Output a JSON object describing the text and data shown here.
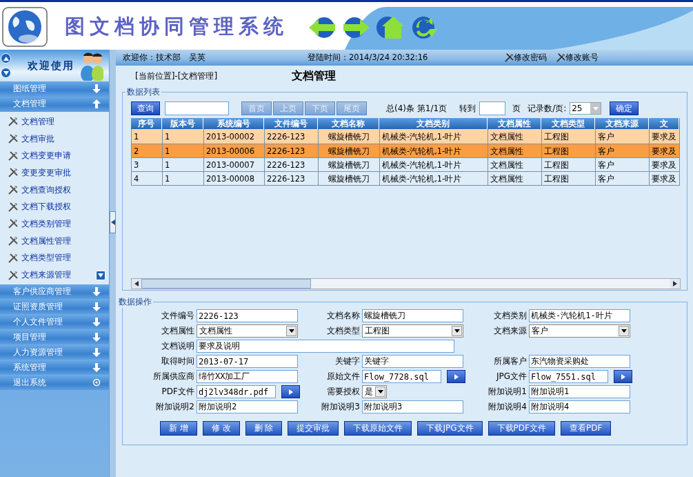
{
  "header": {
    "title": "图文档协同管理系统"
  },
  "sidebar": {
    "banner": "欢迎使用",
    "groups": [
      {
        "label": "图纸管理",
        "kind": "group",
        "expanded": false
      },
      {
        "label": "文档管理",
        "kind": "group",
        "expanded": true,
        "children": [
          "文档管理",
          "文档审批",
          "文档变更申请",
          "变更变更审批",
          "文档查询授权",
          "文档下载授权",
          "文档类别管理",
          "文档属性管理",
          "文档类型管理",
          "文档来源管理"
        ]
      },
      {
        "label": "客户供应商管理",
        "kind": "group",
        "expanded": false
      },
      {
        "label": "证照资质管理",
        "kind": "group",
        "expanded": false
      },
      {
        "label": "个人文件管理",
        "kind": "group",
        "expanded": false
      },
      {
        "label": "项目管理",
        "kind": "group",
        "expanded": false
      },
      {
        "label": "人力资源管理",
        "kind": "group",
        "expanded": false
      },
      {
        "label": "系统管理",
        "kind": "group",
        "expanded": false
      },
      {
        "label": "退出系统",
        "kind": "exit",
        "expanded": false
      }
    ]
  },
  "topbar": {
    "welcome": "欢迎你：",
    "department": "技术部",
    "user": "吴英",
    "login_time": "登陆时间：2014/3/24 20:32:16",
    "links": [
      "修改密码",
      "修改账号"
    ]
  },
  "breadcrumb": "[当前位置]-[文档管理]",
  "page_title": "文档管理",
  "list": {
    "legend": "数据列表",
    "query_button": "查询",
    "pager_buttons": [
      {
        "label": "首页",
        "disabled": true
      },
      {
        "label": "上页",
        "disabled": true
      },
      {
        "label": "下页",
        "disabled": true
      },
      {
        "label": "尾页",
        "disabled": true
      }
    ],
    "summary": "总(4)条 第1/1页",
    "goto_label": "转到",
    "page_unit": "页",
    "per_page_label": "记录数/页:",
    "per_page": "25",
    "confirm_button": "确定",
    "columns": [
      "序号",
      "版本号",
      "系统编号",
      "文件编号",
      "文档名称",
      "文档类别",
      "文档属性",
      "文档类型",
      "文档来源",
      "文"
    ],
    "rows": [
      {
        "cells": [
          "1",
          "1",
          "2013-00002",
          "2226-123",
          "螺旋槽铣刀",
          "机械类-汽轮机,1-叶片",
          "文档属性",
          "工程图",
          "客户",
          "要求及"
        ],
        "hovered": true,
        "selected": false
      },
      {
        "cells": [
          "2",
          "1",
          "2013-00006",
          "2226-123",
          "螺旋槽铣刀",
          "机械类-汽轮机,1-叶片",
          "文档属性",
          "工程图",
          "客户",
          "要求及"
        ],
        "hovered": false,
        "selected": true
      },
      {
        "cells": [
          "3",
          "1",
          "2013-00007",
          "2226-123",
          "螺旋槽铣刀",
          "机械类-汽轮机,1-叶片",
          "文档属性",
          "工程图",
          "客户",
          "要求及"
        ],
        "hovered": false,
        "selected": false
      },
      {
        "cells": [
          "4",
          "1",
          "2013-00008",
          "2226-123",
          "螺旋槽铣刀",
          "机械类-汽轮机,1-叶片",
          "文档属性",
          "工程图",
          "客户",
          "要求及"
        ],
        "hovered": false,
        "selected": false
      }
    ]
  },
  "form": {
    "legend": "数据操作",
    "rows": [
      [
        {
          "label": "文件编号",
          "kind": "text",
          "value": "2226-123"
        },
        {
          "label": "文档名称",
          "kind": "text",
          "value": "螺旋槽铣刀"
        },
        {
          "label": "文档类别",
          "kind": "text",
          "value": "机械类-汽轮机1-叶片"
        }
      ],
      [
        {
          "label": "文档属性",
          "kind": "select",
          "value": "文档属性"
        },
        {
          "label": "文档类型",
          "kind": "select",
          "value": "工程图"
        },
        {
          "label": "文档来源",
          "kind": "select",
          "value": "客户"
        }
      ],
      [
        {
          "label": "文档说明",
          "kind": "wide",
          "value": "要求及说明"
        }
      ],
      [
        {
          "label": "取得时间",
          "kind": "text",
          "value": "2013-07-17"
        },
        {
          "label": "关键字",
          "kind": "text",
          "value": "关键字"
        },
        {
          "label": "所属客户",
          "kind": "text",
          "value": "东汽物资采购处"
        }
      ],
      [
        {
          "label": "所属供应商",
          "kind": "text",
          "value": "绵竹XX加工厂"
        },
        {
          "label": "原始文件",
          "kind": "file",
          "value": "Flow_7728.sql"
        },
        {
          "label": "JPG文件",
          "kind": "file",
          "value": "Flow_7551.sql"
        }
      ],
      [
        {
          "label": "PDF文件",
          "kind": "file",
          "value": "dj2lv348dr.pdf"
        },
        {
          "label": "需要授权",
          "kind": "small-select",
          "value": "是"
        },
        {
          "label": "附加说明1",
          "kind": "text",
          "value": "附加说明1"
        }
      ],
      [
        {
          "label": "附加说明2",
          "kind": "text",
          "value": "附加说明2"
        },
        {
          "label": "附加说明3",
          "kind": "text",
          "value": "附加说明3"
        },
        {
          "label": "附加说明4",
          "kind": "text",
          "value": "附加说明4"
        }
      ]
    ],
    "buttons": [
      "新 增",
      "修 改",
      "删 除",
      "提交审批",
      "下载原始文件",
      "下载JPG文件",
      "下载PDF文件",
      "查看PDF"
    ]
  }
}
